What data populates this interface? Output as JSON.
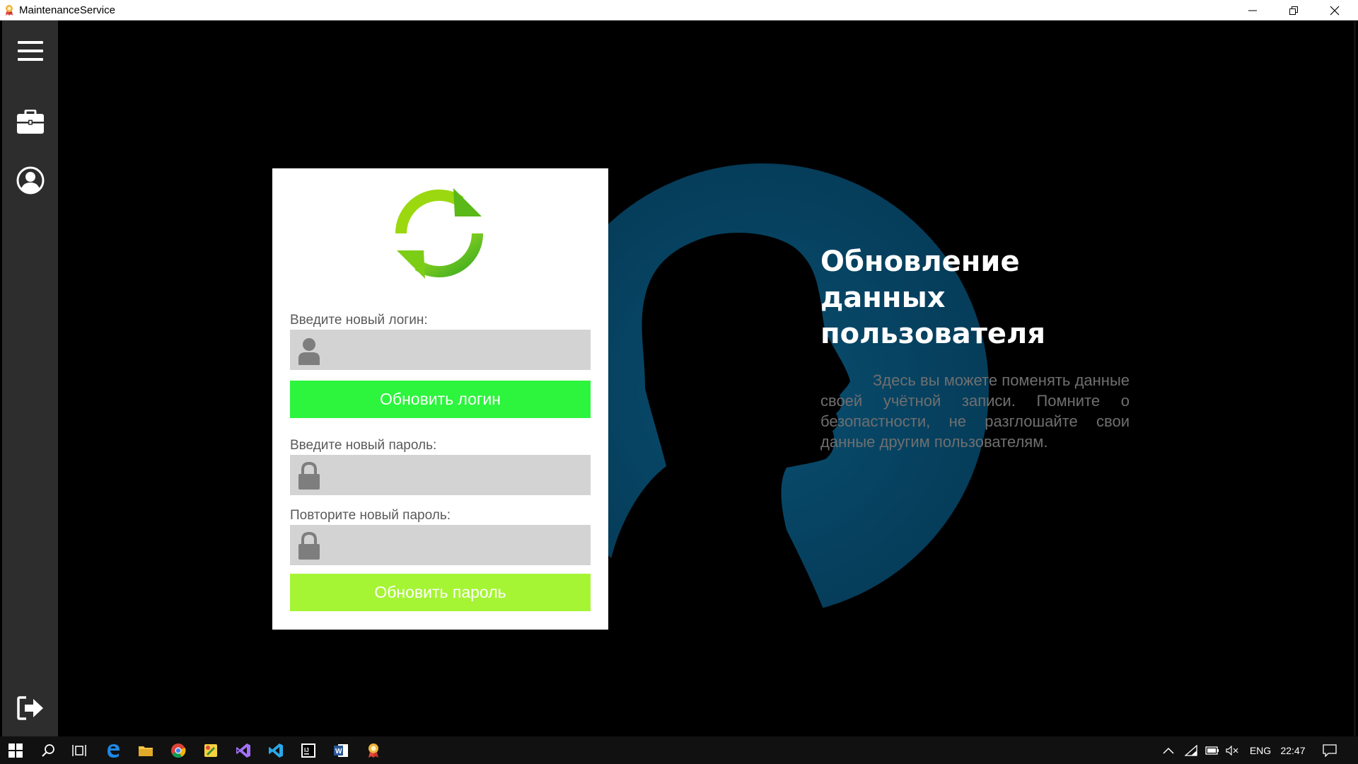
{
  "window": {
    "title": "MaintenanceService"
  },
  "sidebar": {
    "items": [
      {
        "icon": "hamburger-menu-icon"
      },
      {
        "icon": "briefcase-icon"
      },
      {
        "icon": "user-account-icon"
      },
      {
        "icon": "logout-icon"
      }
    ]
  },
  "form": {
    "login_label": "Введите новый логин:",
    "login_value": "",
    "login_button": "Обновить логин",
    "password_label": "Введите новый пароль:",
    "password_value": "",
    "repeat_label": "Повторите новый пароль:",
    "repeat_value": "",
    "password_button": "Обновить пароль"
  },
  "info": {
    "headline": "Обновление данных пользователя",
    "description": "Здесь вы можете поменять данные своей учётной записи. Помните о безопастности, не разглошайте свои данные другим пользователям."
  },
  "colors": {
    "accent_green": "#2df43d",
    "accent_lime": "#a5f534",
    "sidebar_bg": "#2d2d2d",
    "field_bg": "#d3d3d3"
  },
  "taskbar": {
    "apps": [
      "windows-start-icon",
      "search-icon",
      "task-view-icon",
      "edge-icon",
      "file-explorer-icon",
      "chrome-icon",
      "paint-icon",
      "visual-studio-icon",
      "vscode-icon",
      "intellij-icon",
      "word-icon",
      "maintenance-app-icon"
    ],
    "language": "ENG",
    "time": "22:47"
  }
}
